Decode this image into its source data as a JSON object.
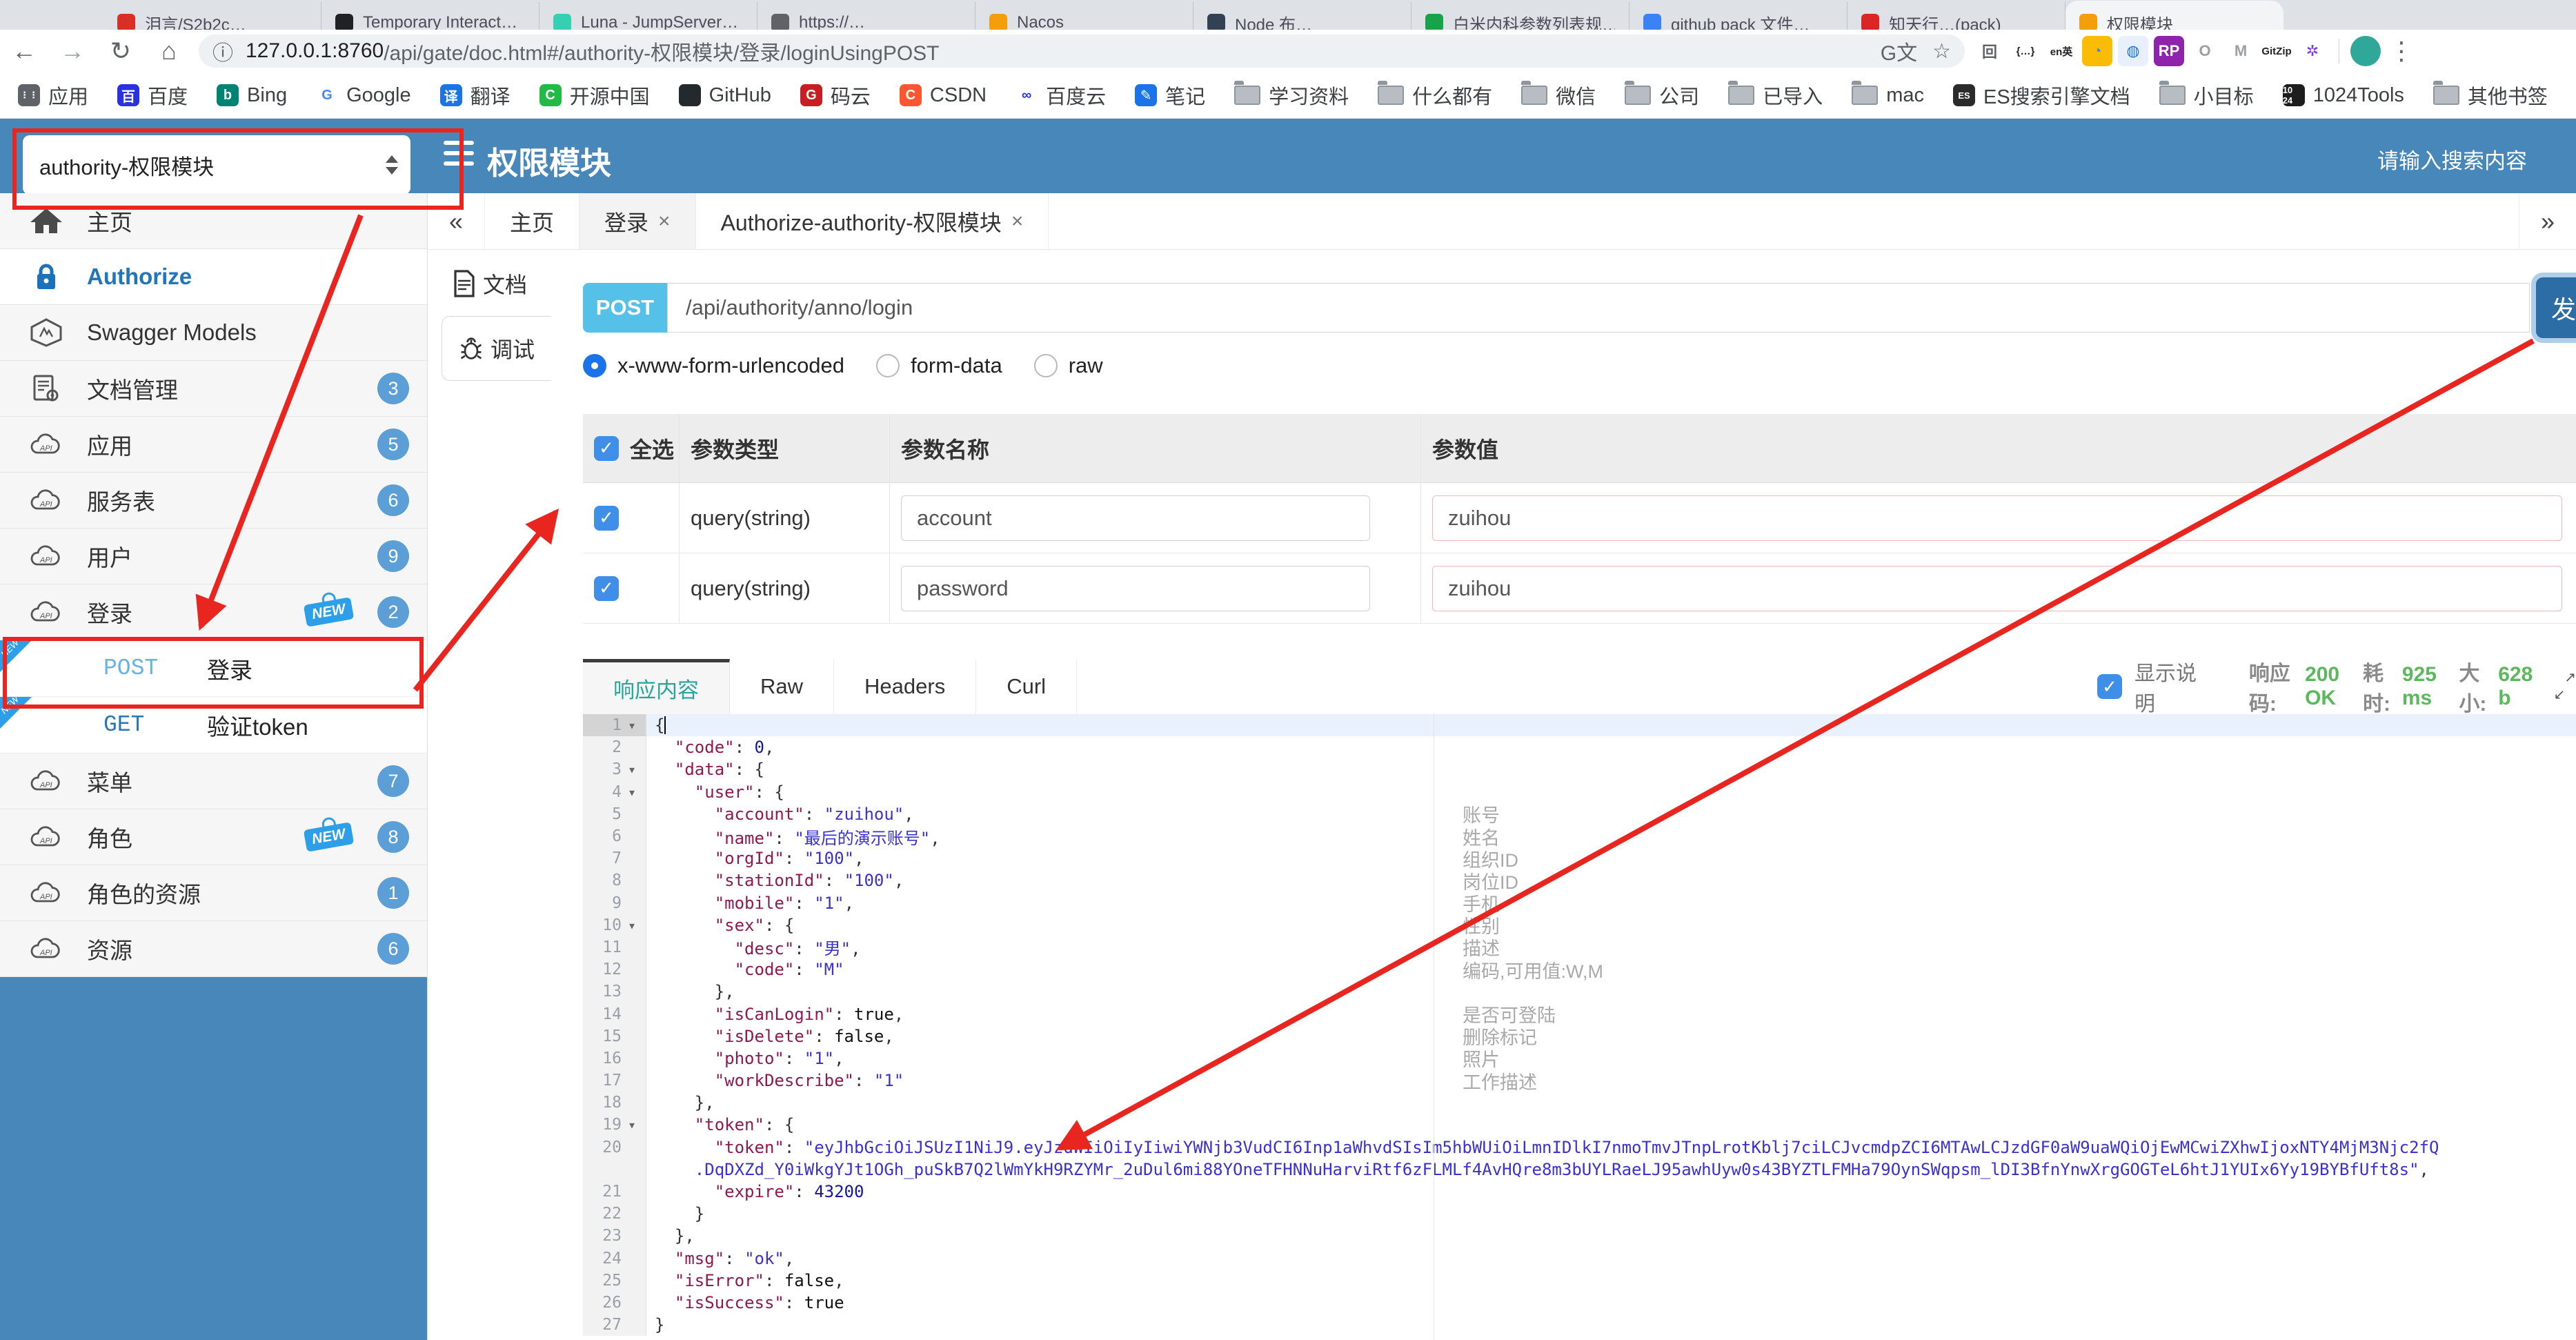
{
  "browser": {
    "tabs": [
      {
        "title": "泪言/S2b2c…",
        "color": "#d93025"
      },
      {
        "title": "Temporary Interact…",
        "color": "#202124"
      },
      {
        "title": "Luna - JumpServer…",
        "color": "#35d0b4"
      },
      {
        "title": "https://…",
        "color": "#5f6368"
      },
      {
        "title": "Nacos",
        "color": "#f59e0b"
      },
      {
        "title": "Node 布…",
        "color": "#334155"
      },
      {
        "title": "白米内科参数列表规…",
        "color": "#16a34a"
      },
      {
        "title": "github pack 文件…",
        "color": "#3b82f6"
      },
      {
        "title": "知天行…(pack)",
        "color": "#dc2626"
      },
      {
        "title": "权限模块",
        "color": "#f59e0b",
        "active": true
      }
    ],
    "nav_icons": [
      {
        "name": "back-icon",
        "glyph": "←",
        "dim": false
      },
      {
        "name": "forward-icon",
        "glyph": "→",
        "dim": true
      },
      {
        "name": "reload-icon",
        "glyph": "↻",
        "dim": false
      },
      {
        "name": "home-icon",
        "glyph": "⌂",
        "dim": false
      }
    ],
    "omnibox": {
      "info_glyph": "ⓘ",
      "url_host": "127.0.0.1:8760",
      "url_path": "/api/gate/doc.html#/authority-权限模块/登录/loginUsingPOST",
      "translate_glyph": "G文",
      "star_glyph": "☆"
    },
    "extensions": [
      {
        "name": "ext-grid-icon",
        "ch": "回",
        "fg": "#5f6368",
        "bg": "#fff"
      },
      {
        "name": "ext-braces-icon",
        "ch": "{…}",
        "fg": "#202124",
        "bg": "#fff"
      },
      {
        "name": "ext-translate-en-icon",
        "ch": "en英",
        "fg": "#202124",
        "bg": "#fff"
      },
      {
        "name": "ext-chrome-icon",
        "ch": "◔",
        "fg": "#4285f4",
        "bg": "#fbbc05"
      },
      {
        "name": "ext-globe-icon",
        "ch": "◍",
        "fg": "#1a73e8",
        "bg": "#e8f0fe"
      },
      {
        "name": "ext-rp-icon",
        "ch": "RP",
        "fg": "#fff",
        "bg": "#8e24aa"
      },
      {
        "name": "ext-ring-icon",
        "ch": "O",
        "fg": "#9aa0a6",
        "bg": "#fff"
      },
      {
        "name": "ext-tampermonkey-icon",
        "ch": "M",
        "fg": "#9aa0a6",
        "bg": "#fff"
      },
      {
        "name": "ext-gitzip-icon",
        "ch": "GitZip",
        "fg": "#202124",
        "bg": "#fff"
      },
      {
        "name": "ext-asterisk-icon",
        "ch": "✲",
        "fg": "#7c3aed",
        "bg": "#fff"
      }
    ],
    "avatar_color": "#2fa89a",
    "menu_glyph": "⋮",
    "bookmarks": [
      {
        "label": "应用",
        "kind": "letter",
        "ch": "⋮⋮",
        "color": "#5f6368",
        "fg": "#fff"
      },
      {
        "label": "百度",
        "kind": "letter",
        "ch": "百",
        "color": "#2932e1",
        "fg": "#fff"
      },
      {
        "label": "Bing",
        "kind": "letter",
        "ch": "b",
        "color": "#008373",
        "fg": "#fff"
      },
      {
        "label": "Google",
        "kind": "letter",
        "ch": "G",
        "color": "#fff",
        "fg": "#4285f4"
      },
      {
        "label": "翻译",
        "kind": "letter",
        "ch": "译",
        "color": "#1a73e8",
        "fg": "#fff"
      },
      {
        "label": "开源中国",
        "kind": "letter",
        "ch": "C",
        "color": "#21ba45",
        "fg": "#fff"
      },
      {
        "label": "GitHub",
        "kind": "letter",
        "ch": "",
        "color": "#24292e",
        "fg": "#fff"
      },
      {
        "label": "码云",
        "kind": "letter",
        "ch": "G",
        "color": "#c71d23",
        "fg": "#fff"
      },
      {
        "label": "CSDN",
        "kind": "letter",
        "ch": "C",
        "color": "#fc5531",
        "fg": "#fff"
      },
      {
        "label": "百度云",
        "kind": "letter",
        "ch": "∞",
        "color": "#fff",
        "fg": "#2932e1"
      },
      {
        "label": "笔记",
        "kind": "letter",
        "ch": "✎",
        "color": "#1a73e8",
        "fg": "#fff"
      },
      {
        "label": "学习资料",
        "kind": "folder"
      },
      {
        "label": "什么都有",
        "kind": "folder"
      },
      {
        "label": "微信",
        "kind": "folder"
      },
      {
        "label": "公司",
        "kind": "folder"
      },
      {
        "label": "已导入",
        "kind": "folder"
      },
      {
        "label": "mac",
        "kind": "folder"
      },
      {
        "label": "ES搜索引擎文档",
        "kind": "letter",
        "ch": "ES",
        "color": "#2b2b2b",
        "fg": "#fff"
      },
      {
        "label": "小目标",
        "kind": "folder"
      },
      {
        "label": "1024Tools",
        "kind": "letter",
        "ch": "10 24",
        "color": "#1d1d1d",
        "fg": "#fff"
      },
      {
        "label": "其他书签",
        "kind": "folder"
      }
    ]
  },
  "header": {
    "select_value": "authority-权限模块",
    "title": "权限模块",
    "search_placeholder": "请输入搜索内容"
  },
  "sidebar": {
    "items": [
      {
        "kind": "item",
        "icon": "home",
        "label": "主页"
      },
      {
        "kind": "item",
        "icon": "lock",
        "label": "Authorize",
        "active": true
      },
      {
        "kind": "item",
        "icon": "hexagon",
        "label": "Swagger Models"
      },
      {
        "kind": "item",
        "icon": "docgear",
        "label": "文档管理",
        "badge": "3"
      },
      {
        "kind": "item",
        "icon": "cloudapi",
        "label": "应用",
        "badge": "5"
      },
      {
        "kind": "item",
        "icon": "cloudapi",
        "label": "服务表",
        "badge": "6"
      },
      {
        "kind": "item",
        "icon": "cloudapi",
        "label": "用户",
        "badge": "9"
      },
      {
        "kind": "item",
        "icon": "cloudapi",
        "label": "登录",
        "badge": "2",
        "isNew": true
      },
      {
        "kind": "sub",
        "method": "POST",
        "label": "登录",
        "isNew": true
      },
      {
        "kind": "sub",
        "method": "GET",
        "label": "验证token",
        "isNew": true
      },
      {
        "kind": "item",
        "icon": "cloudapi",
        "label": "菜单",
        "badge": "7"
      },
      {
        "kind": "item",
        "icon": "cloudapi",
        "label": "角色",
        "badge": "8",
        "isNew": true
      },
      {
        "kind": "item",
        "icon": "cloudapi",
        "label": "角色的资源",
        "badge": "1"
      },
      {
        "kind": "item",
        "icon": "cloudapi",
        "label": "资源",
        "badge": "6"
      }
    ]
  },
  "content_tabs": {
    "left_chevron": "«",
    "right_chevron": "»",
    "tabs": [
      {
        "label": "主页",
        "closable": false,
        "gray": false
      },
      {
        "label": "登录",
        "closable": true,
        "gray": true
      },
      {
        "label": "Authorize-authority-权限模块",
        "closable": true,
        "gray": false
      }
    ],
    "close_glyph": "×"
  },
  "doc": {
    "side_tabs": [
      {
        "label": "文档",
        "icon": "doc"
      },
      {
        "label": "调试",
        "icon": "bug",
        "active": true
      }
    ],
    "method": "POST",
    "url": "/api/authority/anno/login",
    "send_label": "发",
    "body_types": [
      {
        "label": "x-www-form-urlencoded",
        "selected": true
      },
      {
        "label": "form-data",
        "selected": false
      },
      {
        "label": "raw",
        "selected": false
      }
    ]
  },
  "params": {
    "headers": {
      "all": "全选",
      "type": "参数类型",
      "name": "参数名称",
      "value": "参数值"
    },
    "check_glyph": "✓",
    "rows": [
      {
        "checked": true,
        "type": "query(string)",
        "name": "account",
        "value": "zuihou"
      },
      {
        "checked": true,
        "type": "query(string)",
        "name": "password",
        "value": "zuihou"
      }
    ]
  },
  "response": {
    "tabs": [
      {
        "label": "响应内容",
        "active": true
      },
      {
        "label": "Raw"
      },
      {
        "label": "Headers"
      },
      {
        "label": "Curl"
      }
    ],
    "show_desc_label": "显示说明",
    "meta": [
      {
        "k": "响应码:",
        "v": "200 OK"
      },
      {
        "k": "耗时:",
        "v": "925 ms"
      },
      {
        "k": "大小:",
        "v": "628 b"
      }
    ]
  },
  "editor": {
    "fold_glyph": "▾",
    "lines": [
      {
        "n": 1,
        "fold": true,
        "active": true,
        "seg": [
          [
            "p",
            "{"
          ]
        ]
      },
      {
        "n": 2,
        "seg": [
          [
            "p",
            "  "
          ],
          [
            "k",
            "\"code\""
          ],
          [
            "p",
            ": "
          ],
          [
            "n",
            "0"
          ],
          [
            "p",
            ","
          ]
        ]
      },
      {
        "n": 3,
        "fold": true,
        "seg": [
          [
            "p",
            "  "
          ],
          [
            "k",
            "\"data\""
          ],
          [
            "p",
            ": {"
          ]
        ]
      },
      {
        "n": 4,
        "fold": true,
        "seg": [
          [
            "p",
            "    "
          ],
          [
            "k",
            "\"user\""
          ],
          [
            "p",
            ": {"
          ]
        ]
      },
      {
        "n": 5,
        "ann": "账号",
        "seg": [
          [
            "p",
            "      "
          ],
          [
            "k",
            "\"account\""
          ],
          [
            "p",
            ": "
          ],
          [
            "s",
            "\"zuihou\""
          ],
          [
            "p",
            ","
          ]
        ]
      },
      {
        "n": 6,
        "ann": "姓名",
        "seg": [
          [
            "p",
            "      "
          ],
          [
            "k",
            "\"name\""
          ],
          [
            "p",
            ": "
          ],
          [
            "s",
            "\"最后的演示账号\""
          ],
          [
            "p",
            ","
          ]
        ]
      },
      {
        "n": 7,
        "ann": "组织ID",
        "seg": [
          [
            "p",
            "      "
          ],
          [
            "k",
            "\"orgId\""
          ],
          [
            "p",
            ": "
          ],
          [
            "s",
            "\"100\""
          ],
          [
            "p",
            ","
          ]
        ]
      },
      {
        "n": 8,
        "ann": "岗位ID",
        "seg": [
          [
            "p",
            "      "
          ],
          [
            "k",
            "\"stationId\""
          ],
          [
            "p",
            ": "
          ],
          [
            "s",
            "\"100\""
          ],
          [
            "p",
            ","
          ]
        ]
      },
      {
        "n": 9,
        "ann": "手机",
        "seg": [
          [
            "p",
            "      "
          ],
          [
            "k",
            "\"mobile\""
          ],
          [
            "p",
            ": "
          ],
          [
            "s",
            "\"1\""
          ],
          [
            "p",
            ","
          ]
        ]
      },
      {
        "n": 10,
        "fold": true,
        "ann": "性别",
        "seg": [
          [
            "p",
            "      "
          ],
          [
            "k",
            "\"sex\""
          ],
          [
            "p",
            ": {"
          ]
        ]
      },
      {
        "n": 11,
        "ann": "描述",
        "seg": [
          [
            "p",
            "        "
          ],
          [
            "k",
            "\"desc\""
          ],
          [
            "p",
            ": "
          ],
          [
            "s",
            "\"男\""
          ],
          [
            "p",
            ","
          ]
        ]
      },
      {
        "n": 12,
        "ann": "编码,可用值:W,M",
        "seg": [
          [
            "p",
            "        "
          ],
          [
            "k",
            "\"code\""
          ],
          [
            "p",
            ": "
          ],
          [
            "s",
            "\"M\""
          ]
        ]
      },
      {
        "n": 13,
        "seg": [
          [
            "p",
            "      },"
          ]
        ]
      },
      {
        "n": 14,
        "ann": "是否可登陆",
        "seg": [
          [
            "p",
            "      "
          ],
          [
            "k",
            "\"isCanLogin\""
          ],
          [
            "p",
            ": "
          ],
          [
            "b",
            "true"
          ],
          [
            "p",
            ","
          ]
        ]
      },
      {
        "n": 15,
        "ann": "删除标记",
        "seg": [
          [
            "p",
            "      "
          ],
          [
            "k",
            "\"isDelete\""
          ],
          [
            "p",
            ": "
          ],
          [
            "b",
            "false"
          ],
          [
            "p",
            ","
          ]
        ]
      },
      {
        "n": 16,
        "ann": "照片",
        "seg": [
          [
            "p",
            "      "
          ],
          [
            "k",
            "\"photo\""
          ],
          [
            "p",
            ": "
          ],
          [
            "s",
            "\"1\""
          ],
          [
            "p",
            ","
          ]
        ]
      },
      {
        "n": 17,
        "ann": "工作描述",
        "seg": [
          [
            "p",
            "      "
          ],
          [
            "k",
            "\"workDescribe\""
          ],
          [
            "p",
            ": "
          ],
          [
            "s",
            "\"1\""
          ]
        ]
      },
      {
        "n": 18,
        "seg": [
          [
            "p",
            "    },"
          ]
        ]
      },
      {
        "n": 19,
        "fold": true,
        "seg": [
          [
            "p",
            "    "
          ],
          [
            "k",
            "\"token\""
          ],
          [
            "p",
            ": {"
          ]
        ]
      },
      {
        "n": 20,
        "seg": [
          [
            "p",
            "      "
          ],
          [
            "k",
            "\"token\""
          ],
          [
            "p",
            ": "
          ],
          [
            "s",
            "\"eyJhbGciOiJSUzI1NiJ9.eyJzdWIiOiIyIiwiYWNjb3VudCI6Inp1aWhvdSIsIm5hbWUiOiLmnIDlkI7nmoTmvJTnpLrotKblj7ciLCJvcmdpZCI6MTAwLCJzdGF0aW9uaWQiOjEwMCwiZXhwIjoxNTY4MjM3Njc2fQ"
          ]
        ],
        "wrap": [
          [
            "s",
            "    .DqDXZd_Y0iWkgYJt1OGh_puSkB7Q2lWmYkH9RZYMr_2uDul6mi88YOneTFHNNuHarviRtf6zFLMLf4AvHQre8m3bUYLRaeLJ95awhUyw0s43BYZTLFMHa79OynSWqpsm_lDI3BfnYnwXrgGOGTeL6htJ1YUIx6Yy19BYBfUft8s\""
          ],
          [
            "p",
            ","
          ]
        ]
      },
      {
        "n": 21,
        "seg": [
          [
            "p",
            "      "
          ],
          [
            "k",
            "\"expire\""
          ],
          [
            "p",
            ": "
          ],
          [
            "n",
            "43200"
          ]
        ]
      },
      {
        "n": 22,
        "seg": [
          [
            "p",
            "    }"
          ]
        ]
      },
      {
        "n": 23,
        "seg": [
          [
            "p",
            "  },"
          ]
        ]
      },
      {
        "n": 24,
        "seg": [
          [
            "p",
            "  "
          ],
          [
            "k",
            "\"msg\""
          ],
          [
            "p",
            ": "
          ],
          [
            "s",
            "\"ok\""
          ],
          [
            "p",
            ","
          ]
        ]
      },
      {
        "n": 25,
        "seg": [
          [
            "p",
            "  "
          ],
          [
            "k",
            "\"isError\""
          ],
          [
            "p",
            ": "
          ],
          [
            "b",
            "false"
          ],
          [
            "p",
            ","
          ]
        ]
      },
      {
        "n": 26,
        "seg": [
          [
            "p",
            "  "
          ],
          [
            "k",
            "\"isSuccess\""
          ],
          [
            "p",
            ": "
          ],
          [
            "b",
            "true"
          ]
        ]
      },
      {
        "n": 27,
        "seg": [
          [
            "p",
            "}"
          ]
        ]
      }
    ]
  },
  "colors": {
    "header_blue": "#4787ba",
    "post_badge": "#55c1e9",
    "red_annotation": "#e8251f",
    "badge_blue": "#5b9fd6",
    "success_green": "#5cb85c"
  }
}
